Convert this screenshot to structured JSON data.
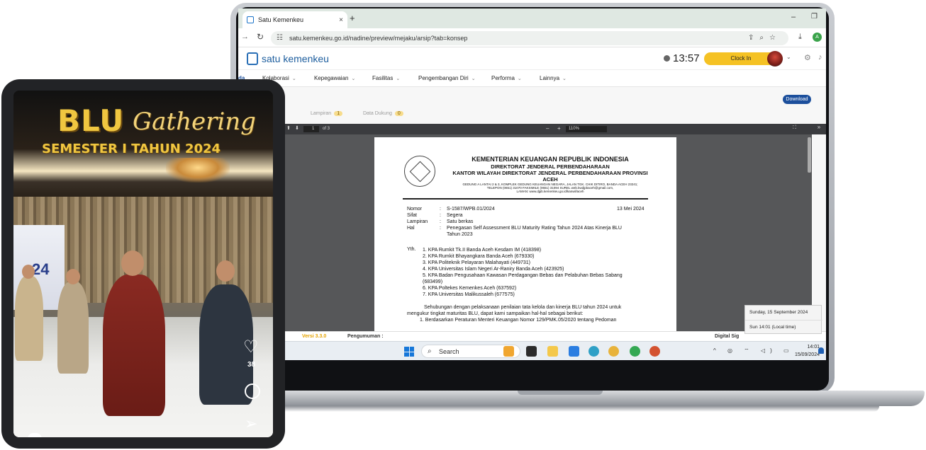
{
  "browser": {
    "tab_title": "Satu Kemenkeu",
    "tab_close": "×",
    "new_tab": "+",
    "minimize": "–",
    "maximize": "❐",
    "url": "satu.kemenkeu.go.id/nadine/preview/mejaku/arsip?tab=konsep",
    "profile_initial": "A"
  },
  "app": {
    "logo_text": "satu kemenkeu",
    "clock_time": "13:57",
    "clock_in_label": "Clock In",
    "menu": [
      {
        "label": "da",
        "chev": ""
      },
      {
        "label": "Kolaborasi",
        "chev": "⌄"
      },
      {
        "label": "Kepegawaian",
        "chev": "⌄"
      },
      {
        "label": "Fasilitas",
        "chev": "⌄"
      },
      {
        "label": "Pengembangan Diri",
        "chev": "⌄"
      },
      {
        "label": "Performa",
        "chev": "⌄"
      },
      {
        "label": "Lainnya",
        "chev": "⌄"
      }
    ],
    "download_label": "Download",
    "subtabs": [
      {
        "label": "Lampiran",
        "count": "1"
      },
      {
        "label": "Data Dukung",
        "count": "0"
      }
    ],
    "footer": {
      "version": "Versi 3.3.0",
      "announcement": "Pengumuman :",
      "digital_sign": "Digital Sig"
    }
  },
  "pdf": {
    "page_current": "1",
    "page_total": "of 3",
    "zoom": "110%",
    "zoom_minus": "–",
    "zoom_plus": "+",
    "sidebar_toggle": "»",
    "fit_icon": "⛶",
    "letterhead": {
      "line1": "KEMENTERIAN KEUANGAN REPUBLIK INDONESIA",
      "line2": "DIREKTORAT JENDERAL PERBENDAHARAAN",
      "line3": "KANTOR WILAYAH DIREKTORAT JENDERAL PERBENDAHARAAN PROVINSI",
      "line4": "ACEH",
      "address1": "GEDUNG A LANTAI 2 & 3, KOMPLEK GEDUNG KEUANGAN NEGARA, JALAN TGK. CHIK DITIRO, BANDA ACEH 23241;",
      "address2": "TELEPON (0651) 31070 FAKSIMILE (0651) 31094 SUREL web.kwdjpbaceh@gmail.com,",
      "address3": "LAMAN: www.djpb.kemenkeu.go.id/kanwil/aceh"
    },
    "meta": [
      {
        "key": "Nomor",
        "value": "S-1587/WPB.01/2024"
      },
      {
        "key": "Sifat",
        "value": "Segera"
      },
      {
        "key": "Lampiran",
        "value": "Satu berkas"
      },
      {
        "key": "Hal",
        "value": "Penegasan Self Assessment BLU Maturity Rating Tahun 2024 Atas Kinerja BLU"
      },
      {
        "key": "",
        "value": "Tahun 2023"
      }
    ],
    "date": "13 Mei 2024",
    "yth": "Yth.",
    "recipients": [
      "1. KPA Rumkit Tk.II Banda Aceh Kesdam IM (418398)",
      "2. KPA Rumkit Bhayangkara Banda Aceh (679330)",
      "3. KPA Politeknik Pelayaran Malahayati (449731)",
      "4. KPA Universitas Islam Negeri Ar-Raniry Banda Aceh (423925)",
      "5. KPA Badan Pengusahaan Kawasan Perdagangan Bebas dan Pelabuhan Bebas Sabang",
      "(683499)",
      "6. KPA Poltekes Kemenkes Aceh (637592)",
      "7. KPA Universitas Malikussaleh (677575)"
    ],
    "body1": "Sehubungan dengan pelaksanaan penilaian tata kelola dan kinerja BLU tahun 2024 untuk",
    "body2": "mengukur tingkat maturitas BLU, dapat kami sampaikan hal-hal sebagai berikut:",
    "body3": "1.   Berdasarkan Peraturan Menteri Keuangan Nomor 129/PMK.05/2020 tentang Pedoman"
  },
  "tooltip": {
    "date": "Sunday, 15 September 2024",
    "time": "Sun 14:01 (Local time)"
  },
  "taskbar": {
    "search_label": "Search",
    "time": "14:01",
    "date": "15/09/2024",
    "tray_icons": "^ ◎ ⌔ ◁) ▭"
  },
  "tablet": {
    "title_blu": "BLU",
    "title_script": "Gathering",
    "subtitle": "SEMESTER I TAHUN 2024",
    "banner_number": "24",
    "likes": "38"
  }
}
